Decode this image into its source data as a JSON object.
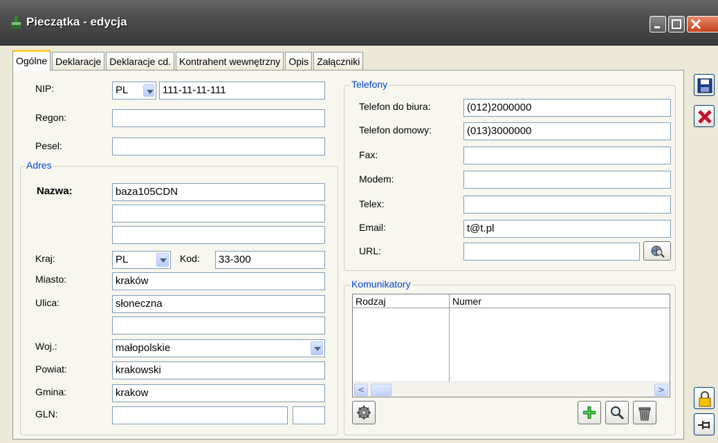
{
  "window": {
    "title": "Pieczątka - edycja"
  },
  "tabs": [
    "Ogólne",
    "Deklaracje",
    "Deklaracje cd.",
    "Kontrahent wewnętrzny",
    "Opis",
    "Załączniki"
  ],
  "form": {
    "nip_label": "NIP:",
    "nip_country": "PL",
    "nip_value": "111-11-11-111",
    "regon_label": "Regon:",
    "regon_value": "",
    "pesel_label": "Pesel:",
    "pesel_value": ""
  },
  "adres": {
    "title": "Adres",
    "nazwa_label": "Nazwa:",
    "nazwa1": "baza105CDN",
    "nazwa2": "",
    "nazwa3": "",
    "kraj_label": "Kraj:",
    "kraj_value": "PL",
    "kod_label": "Kod:",
    "kod_value": "33-300",
    "miasto_label": "Miasto:",
    "miasto_value": "kraków",
    "ulica_label": "Ulica:",
    "ulica_value": "słoneczna",
    "ulica2_value": "",
    "woj_label": "Woj.:",
    "woj_value": "małopolskie",
    "powiat_label": "Powiat:",
    "powiat_value": "krakowski",
    "gmina_label": "Gmina:",
    "gmina_value": "krakow",
    "gln_label": "GLN:",
    "gln_value": "",
    "gln_check": ""
  },
  "telefony": {
    "title": "Telefony",
    "biuro_label": "Telefon do biura:",
    "biuro_value": "(012)2000000",
    "domowy_label": "Telefon domowy:",
    "domowy_value": "(013)3000000",
    "fax_label": "Fax:",
    "fax_value": "",
    "modem_label": "Modem:",
    "modem_value": "",
    "telex_label": "Telex:",
    "telex_value": "",
    "email_label": "Email:",
    "email_value": "t@t.pl",
    "url_label": "URL:",
    "url_value": ""
  },
  "komunikatory": {
    "title": "Komunikatory",
    "columns": [
      "Rodzaj",
      "Numer"
    ]
  },
  "icons": {
    "save": "save-icon",
    "cancel": "cancel-icon",
    "lock": "padlock-icon",
    "pin": "pin-icon",
    "globe": "globe-search-icon",
    "gear": "gear-icon",
    "add": "add-icon",
    "search": "magnifier-icon",
    "delete": "trash-icon"
  }
}
